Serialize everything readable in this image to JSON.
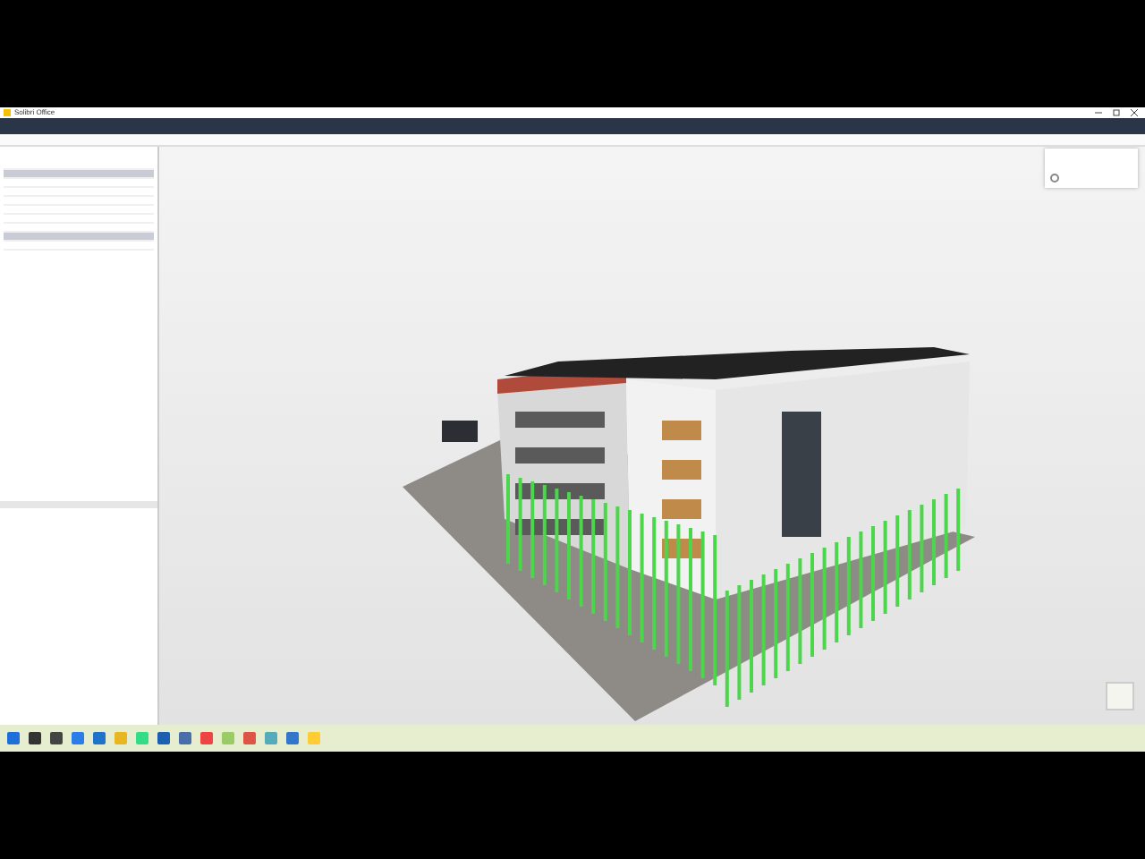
{
  "window": {
    "title": "Solibri Office"
  },
  "tree_rows": [
    {
      "selected": false
    },
    {
      "selected": true
    },
    {
      "selected": false
    },
    {
      "selected": false
    },
    {
      "selected": false
    },
    {
      "selected": false
    },
    {
      "selected": false
    },
    {
      "selected": false
    },
    {
      "selected": true
    },
    {
      "selected": false
    }
  ],
  "popup": {
    "checkbox": {
      "checked": false
    }
  }
}
